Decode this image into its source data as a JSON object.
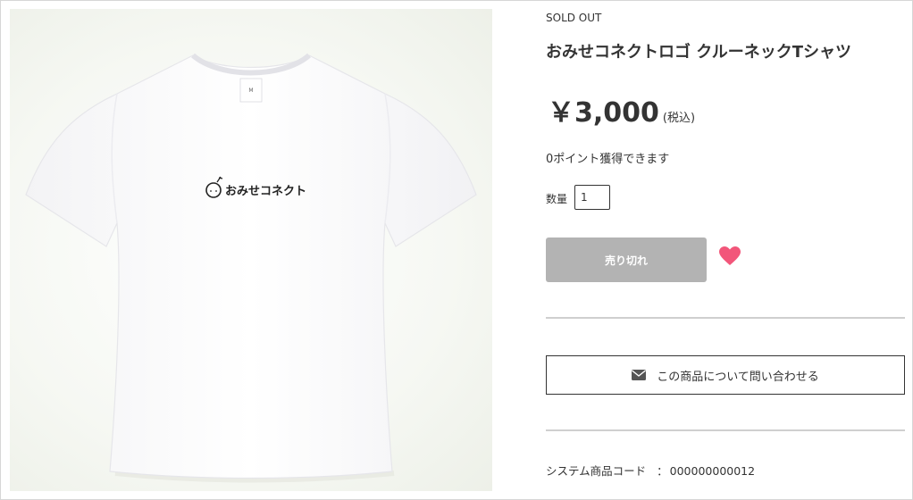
{
  "product": {
    "status": "SOLD OUT",
    "title": "おみせコネクトロゴ クルーネックTシャツ",
    "price": "￥3,000",
    "tax_note": "(税込)",
    "points": "0ポイント獲得できます",
    "image": {
      "logo_text": "おみせコネクト",
      "tag_size": "M"
    }
  },
  "quantity": {
    "label": "数量",
    "value": "1"
  },
  "actions": {
    "soldout_label": "売り切れ",
    "inquiry_label": "この商品について問い合わせる"
  },
  "sku": {
    "label": "システム商品コード",
    "separator": "：",
    "value": "000000000012"
  },
  "icons": {
    "favorite": "heart-icon",
    "inquiry": "mail-icon"
  },
  "colors": {
    "soldout_button": "#b3b3b3",
    "heart": "#f2567a",
    "text": "#333333"
  }
}
